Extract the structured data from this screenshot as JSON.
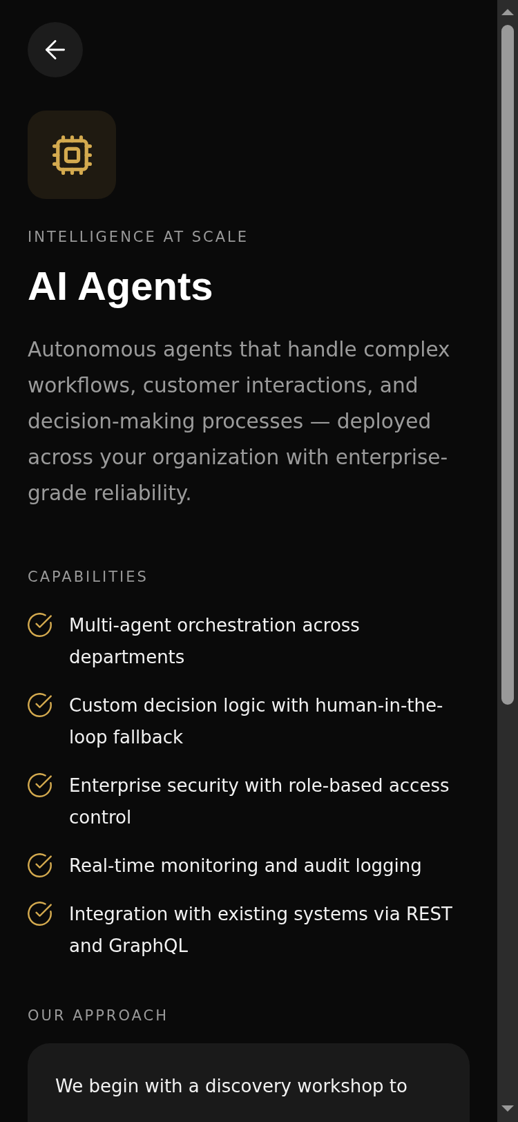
{
  "hero": {
    "eyebrow": "INTELLIGENCE AT SCALE",
    "title": "AI Agents",
    "description": "Autonomous agents that handle complex workflows, customer interactions, and decision-making processes — deployed across your organization with enterprise-grade reliability."
  },
  "capabilities": {
    "heading": "CAPABILITIES",
    "items": [
      "Multi-agent orchestration across departments",
      "Custom decision logic with human-in-the-loop fallback",
      "Enterprise security with role-based access control",
      "Real-time monitoring and audit logging",
      "Integration with existing systems via REST and GraphQL"
    ]
  },
  "approach": {
    "heading": "OUR APPROACH",
    "text": "We begin with a discovery workshop to"
  }
}
